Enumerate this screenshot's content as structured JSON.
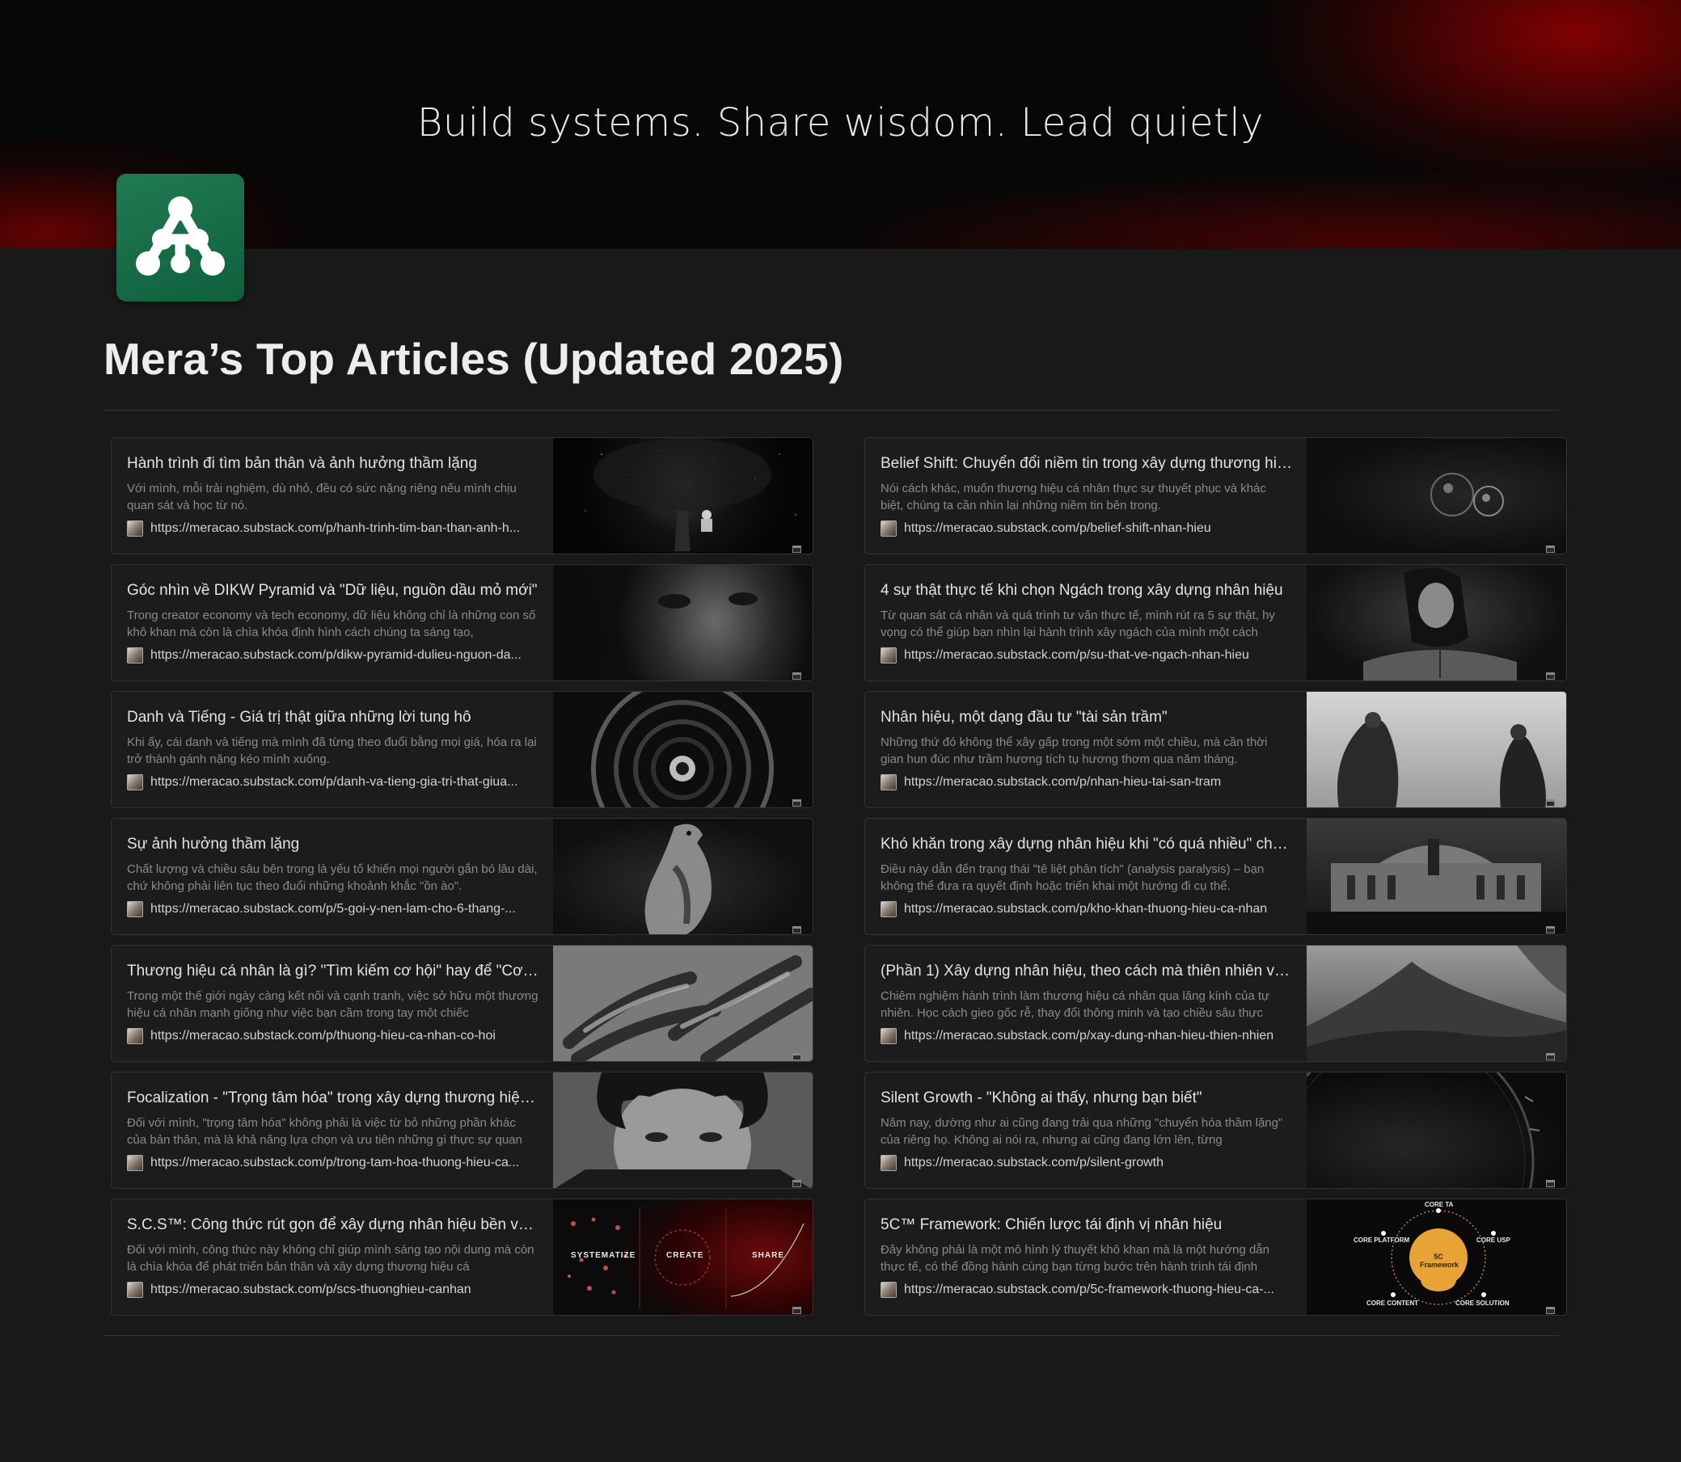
{
  "header": {
    "tagline": "Build systems. Share wisdom. Lead quietly",
    "page_title": "Mera’s Top Articles (Updated 2025)"
  },
  "colors": {
    "background": "#191919",
    "banner_dark": "#070707",
    "banner_red": "#960000",
    "icon_green": "#1a7048",
    "card_border": "#333333"
  },
  "left_column": [
    {
      "title": "Hành trình đi tìm bản thân và ảnh hưởng thầm lặng",
      "description": "Với mình, mỗi trải nghiệm, dù nhỏ, đều có sức nặng riêng nếu mình chịu quan sát và học từ nó.",
      "url": "https://meracao.substack.com/p/hanh-trinh-tim-ban-than-anh-h...",
      "thumb": "tree-reader"
    },
    {
      "title": "Góc nhìn về DIKW Pyramid và \"Dữ liệu, nguồn dầu mỏ mới\"",
      "description": "Trong creator economy và tech economy, dữ liệu không chỉ là những con số khô khan mà còn là chìa khóa định hình cách chúng ta sáng tạo,",
      "url": "https://meracao.substack.com/p/dikw-pyramid-dulieu-nguon-da...",
      "thumb": "face-portrait"
    },
    {
      "title": "Danh và Tiếng - Giá trị thật giữa những lời tung hô",
      "description": "Khi ấy, cái danh và tiếng mà mình đã từng theo đuổi bằng mọi giá, hóa ra lại trở thành gánh nặng kéo mình xuống.",
      "url": "https://meracao.substack.com/p/danh-va-tieng-gia-tri-that-giua...",
      "thumb": "spiral-stairs"
    },
    {
      "title": "Sự ảnh hưởng thầm lặng",
      "description": "Chất lượng và chiều sâu bên trong là yếu tố khiến mọi người gắn bó lâu dài, chứ không phải liên tục theo đuổi những khoảnh khắc \"ồn ào\".",
      "url": "https://meracao.substack.com/p/5-goi-y-nen-lam-cho-6-thang-...",
      "thumb": "hawk"
    },
    {
      "title": "Thương hiệu cá nhân là gì? \"Tìm kiếm cơ hội\" hay để \"Cơ hội...",
      "description": "Trong một thế giới ngày càng kết nối và cạnh tranh, việc sở hữu một thương hiệu cá nhân mạnh giống như việc bạn cầm trong tay một chiếc",
      "url": "https://meracao.substack.com/p/thuong-hieu-ca-nhan-co-hoi",
      "thumb": "hands"
    },
    {
      "title": "Focalization - \"Trọng tâm hóa\" trong xây dựng thương hiệu ...",
      "description": "Đối với mình, \"trọng tâm hóa\" không phải là việc từ bỏ những phần khác của bản thân, mà là khả năng lựa chọn và ưu tiên những gì thực sự quan",
      "url": "https://meracao.substack.com/p/trong-tam-hoa-thuong-hieu-ca...",
      "thumb": "curly-portrait"
    },
    {
      "title": "S.C.S™: Công thức rút gọn để xây dựng nhân hiệu bền vững",
      "description": "Đối với mình, công thức này không chỉ giúp mình sáng tạo nội dung mà còn là chìa khóa để phát triển bản thân và xây dựng thương hiệu cá",
      "url": "https://meracao.substack.com/p/scs-thuonghieu-canhan",
      "thumb": "scs",
      "thumb_labels": [
        "SYSTEMATIZE",
        "CREATE",
        "SHARE"
      ]
    }
  ],
  "right_column": [
    {
      "title": "Belief Shift: Chuyển đổi niềm tin trong xây dựng thương hiệ...",
      "description": "Nói cách khác, muốn thương hiệu cá nhân thực sự thuyết phục và khác biệt, chúng ta cần nhìn lại những niềm tin bên trong.",
      "url": "https://meracao.substack.com/p/belief-shift-nhan-hieu",
      "thumb": "glass-orbs"
    },
    {
      "title": "4 sự thật thực tế khi chọn Ngách trong xây dựng nhân hiệu",
      "description": "Từ quan sát cá nhân và quá trình tư vấn thực tế, mình rút ra 5 sự thật, hy vọng có thể giúp bạn nhìn lại hành trình xây ngách của mình một cách",
      "url": "https://meracao.substack.com/p/su-that-ve-ngach-nhan-hieu",
      "thumb": "woman-reading"
    },
    {
      "title": "Nhân hiệu, một dạng đầu tư \"tài sản trầm\"",
      "description": "Những thứ đó không thể xây gấp trong một sớm một chiều, mà cần thời gian hun đúc như trầm hương tích tụ hương thơm qua năm tháng.",
      "url": "https://meracao.substack.com/p/nhan-hieu-tai-san-tram",
      "thumb": "monks"
    },
    {
      "title": "Khó khăn trong xây dựng nhân hiệu khi \"có quá nhiều\" chất ...",
      "description": "Điều này dẫn đến trạng thái \"tê liệt phân tích\" (analysis paralysis) – bạn không thể đưa ra quyết định hoặc triển khai một hướng đi cụ thể.",
      "url": "https://meracao.substack.com/p/kho-khan-thuong-hieu-ca-nhan",
      "thumb": "opera-house"
    },
    {
      "title": "(Phần 1) Xây dựng nhân hiệu, theo cách mà thiên nhiên vẫn l...",
      "description": "Chiêm nghiệm hành trình làm thương hiệu cá nhân qua lăng kính của tự nhiên. Học cách gieo gốc rễ, thay đổi thông minh và tạo chiều sâu thực",
      "url": "https://meracao.substack.com/p/xay-dung-nhan-hieu-thien-nhien",
      "thumb": "dunes"
    },
    {
      "title": "Silent Growth - \"Không ai thấy, nhưng bạn biết\"",
      "description": "Năm nay, dường như ai cũng đang trải qua những \"chuyển hóa thầm lặng\" của riêng họ. Không ai nói ra, nhưng ai cũng đang lớn lên, từng",
      "url": "https://meracao.substack.com/p/silent-growth",
      "thumb": "clock"
    },
    {
      "title": "5C™ Framework: Chiến lược tái định vị nhân hiệu",
      "description": "Đây không phải là một mô hình lý thuyết khô khan mà là một hướng dẫn thực tế, có thể đồng hành cùng bạn từng bước trên hành trình tái định",
      "url": "https://meracao.substack.com/p/5c-framework-thuong-hieu-ca-...",
      "thumb": "5c",
      "thumb_labels": [
        "CORE TA",
        "CORE PLATFORM",
        "CORE USP",
        "5C Framework",
        "CORE CONTENT",
        "CORE SOLUTION"
      ]
    }
  ]
}
